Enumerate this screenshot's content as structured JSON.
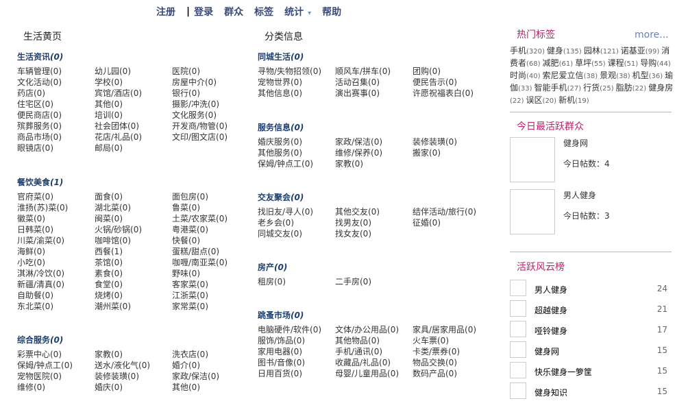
{
  "nav": {
    "register": "注册",
    "sep": "|",
    "login": "登录",
    "groups": "群众",
    "tags": "标签",
    "stats": "统计",
    "stats_arrow": "▾",
    "help": "帮助"
  },
  "columns": {
    "yellow": "生活黄页",
    "classified": "分类信息"
  },
  "yellow_sections": [
    {
      "title": "生活资讯",
      "count": "(0)",
      "items": [
        "车辆管理(0)",
        "幼儿园(0)",
        "医院(0)",
        "文化活动(0)",
        "学校(0)",
        "房屋中介(0)",
        "药店(0)",
        "宾馆/酒店(0)",
        "银行(0)",
        "住宅区(0)",
        "其他(0)",
        "摄影/冲洗(0)",
        "便民商店(0)",
        "培训(0)",
        "文化服务(0)",
        "殡葬服务(0)",
        "社会团体(0)",
        "开发商/物管(0)",
        "商品市场(0)",
        "花店/礼品(0)",
        "文印/图文店(0)",
        "眼镜店(0)",
        "邮局(0)"
      ]
    },
    {
      "title": "餐饮美食",
      "count": "(1)",
      "items": [
        "官府菜(0)",
        "面食(0)",
        "面包房(0)",
        "淮扬(苏)菜(0)",
        "湖北菜(0)",
        "鲁菜(0)",
        "徽菜(0)",
        "闽菜(0)",
        "土菜/农家菜(0)",
        "日韩菜(0)",
        "火锅/砂锅(0)",
        "粤港菜(0)",
        "川菜/渝菜(0)",
        "咖啡馆(0)",
        "快餐(0)",
        "海鲜(0)",
        "西餐(1)",
        "蛋糕/甜点(0)",
        "小吃(0)",
        "茶馆(0)",
        "咖喱/南亚菜(0)",
        "淇淋/冷饮(0)",
        "素食(0)",
        "野味(0)",
        "新疆/清真(0)",
        "食堂(0)",
        "客家菜(0)",
        "自助餐(0)",
        "烧烤(0)",
        "江浙菜(0)",
        "东北菜(0)",
        "潮州菜(0)",
        "家常菜(0)"
      ]
    },
    {
      "title": "综合服务",
      "count": "(0)",
      "items": [
        "彩票中心(0)",
        "家教(0)",
        "洗衣店(0)",
        "保姆/钟点工(0)",
        "送水/液化气(0)",
        "婚介(0)",
        "宠物医院(0)",
        "装修装璜(0)",
        "家政/保洁(0)",
        "维修(0)",
        "婚庆(0)",
        "其他(0)"
      ]
    }
  ],
  "classified_sections": [
    {
      "title": "同城生活",
      "count": "(0)",
      "items": [
        "寻物/失物招领(0)",
        "顺风车/拼车(0)",
        "团购(0)",
        "宠物世界(0)",
        "活动召集(0)",
        "便民告示(0)",
        "其他信息(0)",
        "演出赛事(0)",
        "许愿祝福表白(0)"
      ]
    },
    {
      "title": "服务信息",
      "count": "(0)",
      "items": [
        "婚庆服务(0)",
        "家政/保洁(0)",
        "装修装璜(0)",
        "其他服务(0)",
        "维修/保养(0)",
        "搬家(0)",
        "保姆/钟点工(0)",
        "家教(0)"
      ]
    },
    {
      "title": "交友聚会",
      "count": "(0)",
      "items": [
        "找旧友/寻人(0)",
        "其他交友(0)",
        "结伴活动/旅行(0)",
        "老乡会(0)",
        "找男友(0)",
        "征婚(0)",
        "同城交友(0)",
        "找女友(0)"
      ]
    },
    {
      "title": "房产",
      "count": "(0)",
      "items": [
        "租房(0)",
        "二手房(0)"
      ]
    },
    {
      "title": "跳蚤市场",
      "count": "(0)",
      "items": [
        "电脑硬件/软件(0)",
        "文体/办公用品(0)",
        "家具/居家用品(0)",
        "服饰/饰品(0)",
        "其他物品(0)",
        "火车票(0)",
        "家用电器(0)",
        "手机/通讯(0)",
        "卡类/票券(0)",
        "图书/音像(0)",
        "收藏品/礼品(0)",
        "物品交换(0)",
        "日用百货(0)",
        "母婴/儿童用品(0)",
        "数码产品(0)"
      ]
    }
  ],
  "hot_tags": {
    "title": "热门标签",
    "more": "more...",
    "tags": [
      {
        "name": "手机",
        "count": "(320)"
      },
      {
        "name": "健身",
        "count": "(135)"
      },
      {
        "name": "园林",
        "count": "(121)"
      },
      {
        "name": "诺基亚",
        "count": "(99)"
      },
      {
        "name": "消费者",
        "count": "(68)"
      },
      {
        "name": "减肥",
        "count": "(61)"
      },
      {
        "name": "草坪",
        "count": "(55)"
      },
      {
        "name": "课程",
        "count": "(51)"
      },
      {
        "name": "导购",
        "count": "(44)"
      },
      {
        "name": "时尚",
        "count": "(40)"
      },
      {
        "name": "索尼爱立信",
        "count": "(38)"
      },
      {
        "name": "景观",
        "count": "(38)"
      },
      {
        "name": "机型",
        "count": "(36)"
      },
      {
        "name": "瑜伽",
        "count": "(33)"
      },
      {
        "name": "智能手机",
        "count": "(27)"
      },
      {
        "name": "行货",
        "count": "(25)"
      },
      {
        "name": "脂肪",
        "count": "(22)"
      },
      {
        "name": "健身房",
        "count": "(22)"
      },
      {
        "name": "误区",
        "count": "(20)"
      },
      {
        "name": "新机",
        "count": "(19)"
      }
    ]
  },
  "active_groups": {
    "title": "今日最活跃群众",
    "posts_label": "今日帖数：",
    "groups": [
      {
        "name": "健身网",
        "posts": "4"
      },
      {
        "name": "男人健身",
        "posts": "3"
      }
    ]
  },
  "ranking": {
    "title": "活跃风云榜",
    "items": [
      {
        "name": "男人健身",
        "value": "24"
      },
      {
        "name": "超越健身",
        "value": "21"
      },
      {
        "name": "哑铃健身",
        "value": "17"
      },
      {
        "name": "健身网",
        "value": "15"
      },
      {
        "name": "快乐健身一箩筐",
        "value": "15"
      },
      {
        "name": "健身知识",
        "value": "15"
      }
    ]
  }
}
